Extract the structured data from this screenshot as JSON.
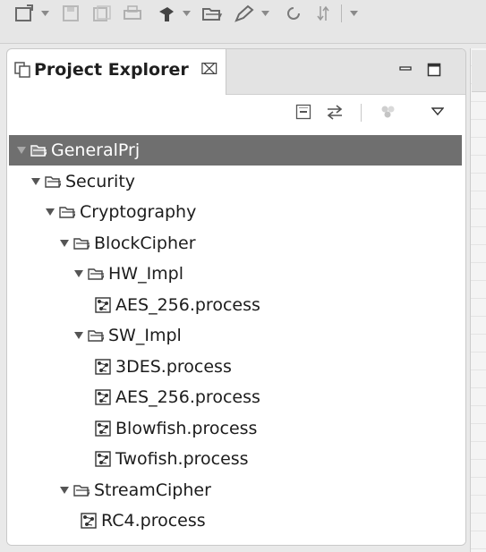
{
  "toolbar": {
    "items": [
      "new-icon",
      "save-icon",
      "save-all-icon",
      "print-icon",
      "build-icon",
      "open-folder-icon",
      "pen-icon",
      "refresh-icon",
      "sort-icon"
    ]
  },
  "panel": {
    "title": "Project Explorer",
    "close_glyph": "⌧"
  },
  "tree": {
    "rows": [
      {
        "label": "GeneralPrj",
        "type": "project",
        "expanded": true,
        "selected": true,
        "depth": 0
      },
      {
        "label": "Security",
        "type": "folder",
        "expanded": true,
        "depth": 1
      },
      {
        "label": "Cryptography",
        "type": "folder",
        "expanded": true,
        "depth": 2
      },
      {
        "label": "BlockCipher",
        "type": "folder",
        "expanded": true,
        "depth": 3
      },
      {
        "label": "HW_Impl",
        "type": "folder",
        "expanded": true,
        "depth": 4
      },
      {
        "label": "AES_256.process",
        "type": "file",
        "depth": 5
      },
      {
        "label": "SW_Impl",
        "type": "folder",
        "expanded": true,
        "depth": 4
      },
      {
        "label": "3DES.process",
        "type": "file",
        "depth": 5
      },
      {
        "label": "AES_256.process",
        "type": "file",
        "depth": 5
      },
      {
        "label": "Blowfish.process",
        "type": "file",
        "depth": 5
      },
      {
        "label": "Twofish.process",
        "type": "file",
        "depth": 5
      },
      {
        "label": "StreamCipher",
        "type": "folder",
        "expanded": true,
        "depth": 3
      },
      {
        "label": "RC4.process",
        "type": "file",
        "depth": 4
      }
    ]
  },
  "colors": {
    "selection": "#6f6f6f",
    "panel_bg": "#ffffff",
    "chrome_bg": "#e6e6e6"
  }
}
